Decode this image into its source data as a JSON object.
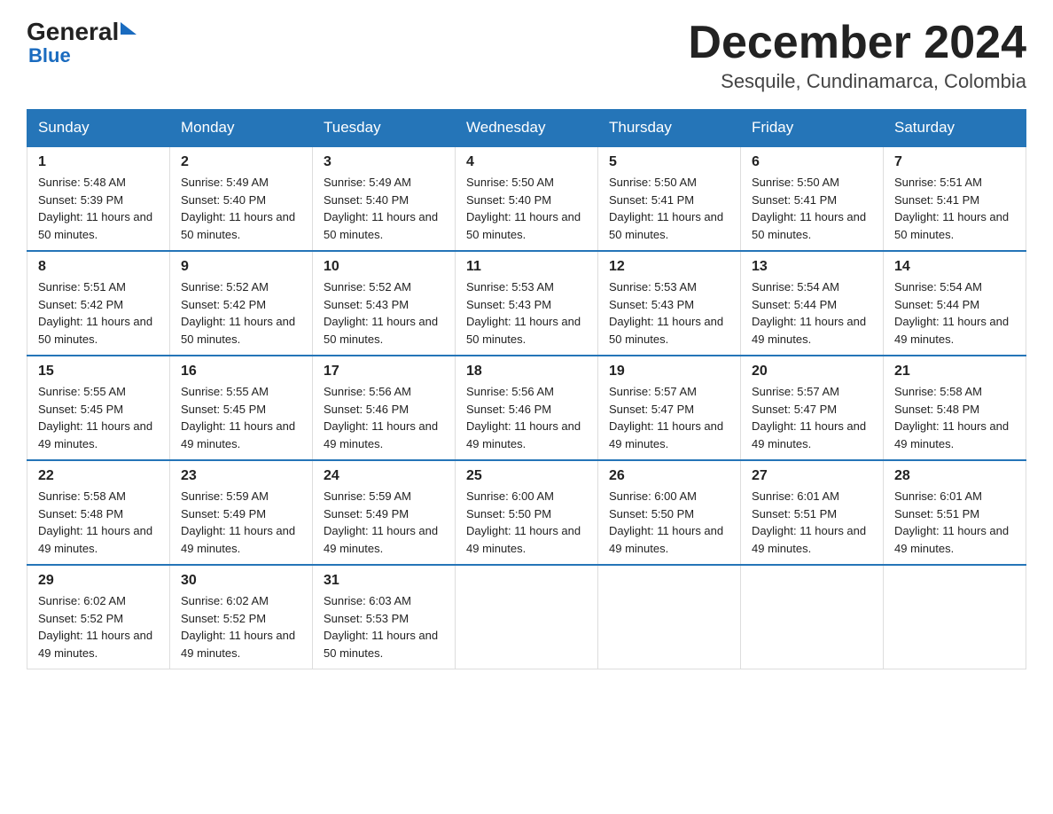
{
  "header": {
    "month_title": "December 2024",
    "location": "Sesquile, Cundinamarca, Colombia",
    "logo_general": "General",
    "logo_blue": "Blue"
  },
  "columns": [
    "Sunday",
    "Monday",
    "Tuesday",
    "Wednesday",
    "Thursday",
    "Friday",
    "Saturday"
  ],
  "weeks": [
    [
      {
        "day": "1",
        "sunrise": "Sunrise: 5:48 AM",
        "sunset": "Sunset: 5:39 PM",
        "daylight": "Daylight: 11 hours and 50 minutes."
      },
      {
        "day": "2",
        "sunrise": "Sunrise: 5:49 AM",
        "sunset": "Sunset: 5:40 PM",
        "daylight": "Daylight: 11 hours and 50 minutes."
      },
      {
        "day": "3",
        "sunrise": "Sunrise: 5:49 AM",
        "sunset": "Sunset: 5:40 PM",
        "daylight": "Daylight: 11 hours and 50 minutes."
      },
      {
        "day": "4",
        "sunrise": "Sunrise: 5:50 AM",
        "sunset": "Sunset: 5:40 PM",
        "daylight": "Daylight: 11 hours and 50 minutes."
      },
      {
        "day": "5",
        "sunrise": "Sunrise: 5:50 AM",
        "sunset": "Sunset: 5:41 PM",
        "daylight": "Daylight: 11 hours and 50 minutes."
      },
      {
        "day": "6",
        "sunrise": "Sunrise: 5:50 AM",
        "sunset": "Sunset: 5:41 PM",
        "daylight": "Daylight: 11 hours and 50 minutes."
      },
      {
        "day": "7",
        "sunrise": "Sunrise: 5:51 AM",
        "sunset": "Sunset: 5:41 PM",
        "daylight": "Daylight: 11 hours and 50 minutes."
      }
    ],
    [
      {
        "day": "8",
        "sunrise": "Sunrise: 5:51 AM",
        "sunset": "Sunset: 5:42 PM",
        "daylight": "Daylight: 11 hours and 50 minutes."
      },
      {
        "day": "9",
        "sunrise": "Sunrise: 5:52 AM",
        "sunset": "Sunset: 5:42 PM",
        "daylight": "Daylight: 11 hours and 50 minutes."
      },
      {
        "day": "10",
        "sunrise": "Sunrise: 5:52 AM",
        "sunset": "Sunset: 5:43 PM",
        "daylight": "Daylight: 11 hours and 50 minutes."
      },
      {
        "day": "11",
        "sunrise": "Sunrise: 5:53 AM",
        "sunset": "Sunset: 5:43 PM",
        "daylight": "Daylight: 11 hours and 50 minutes."
      },
      {
        "day": "12",
        "sunrise": "Sunrise: 5:53 AM",
        "sunset": "Sunset: 5:43 PM",
        "daylight": "Daylight: 11 hours and 50 minutes."
      },
      {
        "day": "13",
        "sunrise": "Sunrise: 5:54 AM",
        "sunset": "Sunset: 5:44 PM",
        "daylight": "Daylight: 11 hours and 49 minutes."
      },
      {
        "day": "14",
        "sunrise": "Sunrise: 5:54 AM",
        "sunset": "Sunset: 5:44 PM",
        "daylight": "Daylight: 11 hours and 49 minutes."
      }
    ],
    [
      {
        "day": "15",
        "sunrise": "Sunrise: 5:55 AM",
        "sunset": "Sunset: 5:45 PM",
        "daylight": "Daylight: 11 hours and 49 minutes."
      },
      {
        "day": "16",
        "sunrise": "Sunrise: 5:55 AM",
        "sunset": "Sunset: 5:45 PM",
        "daylight": "Daylight: 11 hours and 49 minutes."
      },
      {
        "day": "17",
        "sunrise": "Sunrise: 5:56 AM",
        "sunset": "Sunset: 5:46 PM",
        "daylight": "Daylight: 11 hours and 49 minutes."
      },
      {
        "day": "18",
        "sunrise": "Sunrise: 5:56 AM",
        "sunset": "Sunset: 5:46 PM",
        "daylight": "Daylight: 11 hours and 49 minutes."
      },
      {
        "day": "19",
        "sunrise": "Sunrise: 5:57 AM",
        "sunset": "Sunset: 5:47 PM",
        "daylight": "Daylight: 11 hours and 49 minutes."
      },
      {
        "day": "20",
        "sunrise": "Sunrise: 5:57 AM",
        "sunset": "Sunset: 5:47 PM",
        "daylight": "Daylight: 11 hours and 49 minutes."
      },
      {
        "day": "21",
        "sunrise": "Sunrise: 5:58 AM",
        "sunset": "Sunset: 5:48 PM",
        "daylight": "Daylight: 11 hours and 49 minutes."
      }
    ],
    [
      {
        "day": "22",
        "sunrise": "Sunrise: 5:58 AM",
        "sunset": "Sunset: 5:48 PM",
        "daylight": "Daylight: 11 hours and 49 minutes."
      },
      {
        "day": "23",
        "sunrise": "Sunrise: 5:59 AM",
        "sunset": "Sunset: 5:49 PM",
        "daylight": "Daylight: 11 hours and 49 minutes."
      },
      {
        "day": "24",
        "sunrise": "Sunrise: 5:59 AM",
        "sunset": "Sunset: 5:49 PM",
        "daylight": "Daylight: 11 hours and 49 minutes."
      },
      {
        "day": "25",
        "sunrise": "Sunrise: 6:00 AM",
        "sunset": "Sunset: 5:50 PM",
        "daylight": "Daylight: 11 hours and 49 minutes."
      },
      {
        "day": "26",
        "sunrise": "Sunrise: 6:00 AM",
        "sunset": "Sunset: 5:50 PM",
        "daylight": "Daylight: 11 hours and 49 minutes."
      },
      {
        "day": "27",
        "sunrise": "Sunrise: 6:01 AM",
        "sunset": "Sunset: 5:51 PM",
        "daylight": "Daylight: 11 hours and 49 minutes."
      },
      {
        "day": "28",
        "sunrise": "Sunrise: 6:01 AM",
        "sunset": "Sunset: 5:51 PM",
        "daylight": "Daylight: 11 hours and 49 minutes."
      }
    ],
    [
      {
        "day": "29",
        "sunrise": "Sunrise: 6:02 AM",
        "sunset": "Sunset: 5:52 PM",
        "daylight": "Daylight: 11 hours and 49 minutes."
      },
      {
        "day": "30",
        "sunrise": "Sunrise: 6:02 AM",
        "sunset": "Sunset: 5:52 PM",
        "daylight": "Daylight: 11 hours and 49 minutes."
      },
      {
        "day": "31",
        "sunrise": "Sunrise: 6:03 AM",
        "sunset": "Sunset: 5:53 PM",
        "daylight": "Daylight: 11 hours and 50 minutes."
      },
      null,
      null,
      null,
      null
    ]
  ]
}
